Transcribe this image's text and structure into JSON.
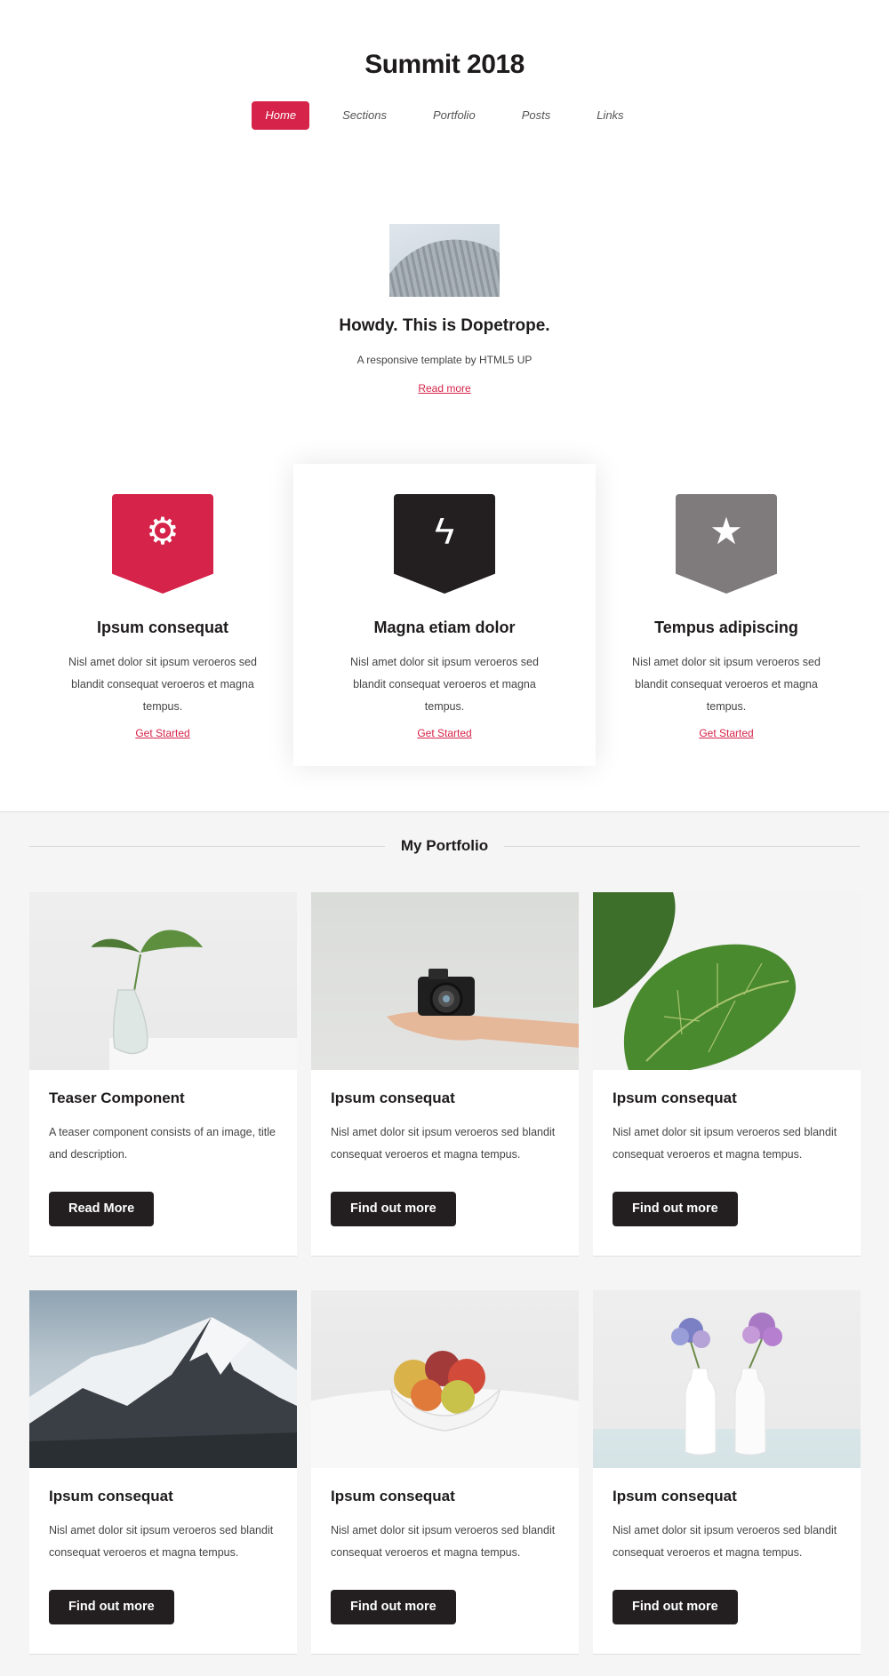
{
  "header": {
    "site_title": "Summit 2018",
    "nav": [
      {
        "label": "Home",
        "active": true
      },
      {
        "label": "Sections",
        "active": false
      },
      {
        "label": "Portfolio",
        "active": false
      },
      {
        "label": "Posts",
        "active": false
      },
      {
        "label": "Links",
        "active": false
      }
    ]
  },
  "hero": {
    "title": "Howdy. This is Dopetrope.",
    "subtitle": "A responsive template by HTML5 UP",
    "link": "Read more"
  },
  "features": [
    {
      "icon": "gear-icon",
      "color": "#d52349",
      "title": "Ipsum consequat",
      "text": "Nisl amet dolor sit ipsum veroeros sed blandit consequat veroeros et magna tempus.",
      "link": "Get Started"
    },
    {
      "icon": "bolt-icon",
      "color": "#231f20",
      "title": "Magna etiam dolor",
      "text": "Nisl amet dolor sit ipsum veroeros sed blandit consequat veroeros et magna tempus.",
      "link": "Get Started"
    },
    {
      "icon": "star-icon",
      "color": "#7f7a7b",
      "title": "Tempus adipiscing",
      "text": "Nisl amet dolor sit ipsum veroeros sed blandit consequat veroeros et magna tempus.",
      "link": "Get Started"
    }
  ],
  "portfolio": {
    "title": "My Portfolio",
    "cards": [
      {
        "image": "plant-in-vase",
        "title": "Teaser Component",
        "text": "A teaser component consists of an image, title and description.",
        "button": "Read More"
      },
      {
        "image": "camera-on-hand",
        "title": "Ipsum consequat",
        "text": "Nisl amet dolor sit ipsum veroeros sed blandit consequat veroeros et magna tempus.",
        "button": "Find out more"
      },
      {
        "image": "green-leaf",
        "title": "Ipsum consequat",
        "text": "Nisl amet dolor sit ipsum veroeros sed blandit consequat veroeros et magna tempus.",
        "button": "Find out more"
      },
      {
        "image": "snowy-mountain",
        "title": "Ipsum consequat",
        "text": "Nisl amet dolor sit ipsum veroeros sed blandit consequat veroeros et magna tempus.",
        "button": "Find out more"
      },
      {
        "image": "fruit-bowl",
        "title": "Ipsum consequat",
        "text": "Nisl amet dolor sit ipsum veroeros sed blandit consequat veroeros et magna tempus.",
        "button": "Find out more"
      },
      {
        "image": "flower-vases",
        "title": "Ipsum consequat",
        "text": "Nisl amet dolor sit ipsum veroeros sed blandit consequat veroeros et magna tempus.",
        "button": "Find out more"
      }
    ]
  },
  "colors": {
    "accent": "#d52349",
    "dark": "#231f20",
    "grey": "#7f7a7b"
  }
}
